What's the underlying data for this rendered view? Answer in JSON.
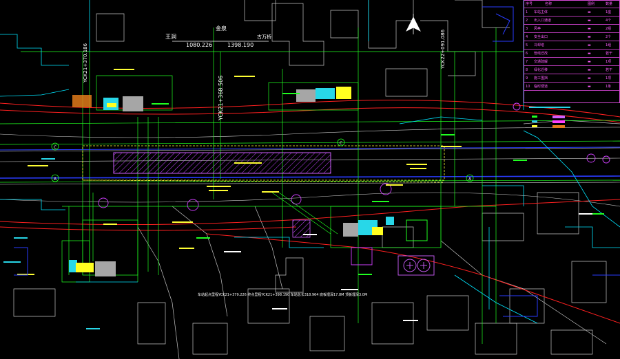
{
  "header_labels": {
    "station_left": "王洞",
    "station_mid": "金泉",
    "station_right": "古万桥",
    "chainage_left": "1080.226",
    "chainage_right": "1398.190"
  },
  "axis_labels": {
    "a_left": "A",
    "a_right": "A",
    "c_left": "C",
    "c_right": "C"
  },
  "vertical_chainages": [
    "YCK21+370.186",
    "YCK21+368.506",
    "YCK22+091.086"
  ],
  "bottom_note": "车站起点里程YCK21+379.226 终点里程YCK21+398.190 车站总长318.964 底板埋深17.8M 顶板埋深3.0M",
  "legend": {
    "header": [
      "序号",
      "名称",
      "图例",
      "数量"
    ],
    "rows": [
      [
        "1",
        "车站主体",
        "▬",
        "1座"
      ],
      [
        "2",
        "出入口通道",
        "▬",
        "4个"
      ],
      [
        "3",
        "风亭",
        "▬",
        "2组"
      ],
      [
        "4",
        "安全出口",
        "▬",
        "2个"
      ],
      [
        "5",
        "冷却塔",
        "▬",
        "1组"
      ],
      [
        "6",
        "管线迁改",
        "▬",
        "若干"
      ],
      [
        "7",
        "交通疏解",
        "▬",
        "1项"
      ],
      [
        "8",
        "绿化迁移",
        "▬",
        "若干"
      ],
      [
        "9",
        "施工围挡",
        "▬",
        "1项"
      ],
      [
        "10",
        "临时便道",
        "▬",
        "1条"
      ]
    ],
    "colors": {
      "border": "#d94ad9",
      "text": "#ff5cff"
    }
  },
  "colors": {
    "background": "#000000",
    "road": "#00ff00",
    "rail": "#ff2020",
    "structure": "#00ffff",
    "station": "#c040ff",
    "building": "#ffffff",
    "yellow": "#ffff00",
    "blue": "#2040ff"
  }
}
